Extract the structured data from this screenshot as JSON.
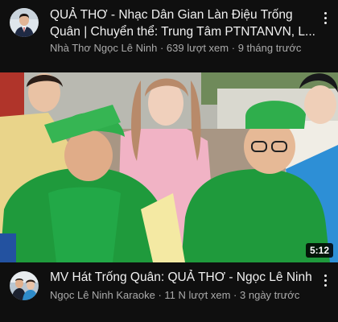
{
  "videos": [
    {
      "title_line1": "QUẢ THƠ -  Nhạc Dân Gian Làn Điệu Trống",
      "title_line2": "Quân | Chuyển thể: Trung Tâm PTNTANVN, L...",
      "channel": "Nhà Thơ Ngọc Lê Ninh",
      "views": "639 lượt xem",
      "age": "9 tháng trước",
      "avatar_icon": "channel-avatar-man-suit",
      "menu_icon": "more-vert-icon"
    },
    {
      "title": "MV Hát Trống Quân: QUẢ THƠ - Ngọc Lê Ninh",
      "channel": "Ngọc Lê Ninh Karaoke",
      "views": "11 N lượt xem",
      "age": "3 ngày trước",
      "duration": "5:12",
      "avatar_icon": "channel-avatar-group",
      "menu_icon": "more-vert-icon"
    }
  ],
  "separator": "·",
  "colors": {
    "background": "#0f0f0f",
    "title_text": "#f1f1f1",
    "meta_text": "#aaaaaa"
  }
}
